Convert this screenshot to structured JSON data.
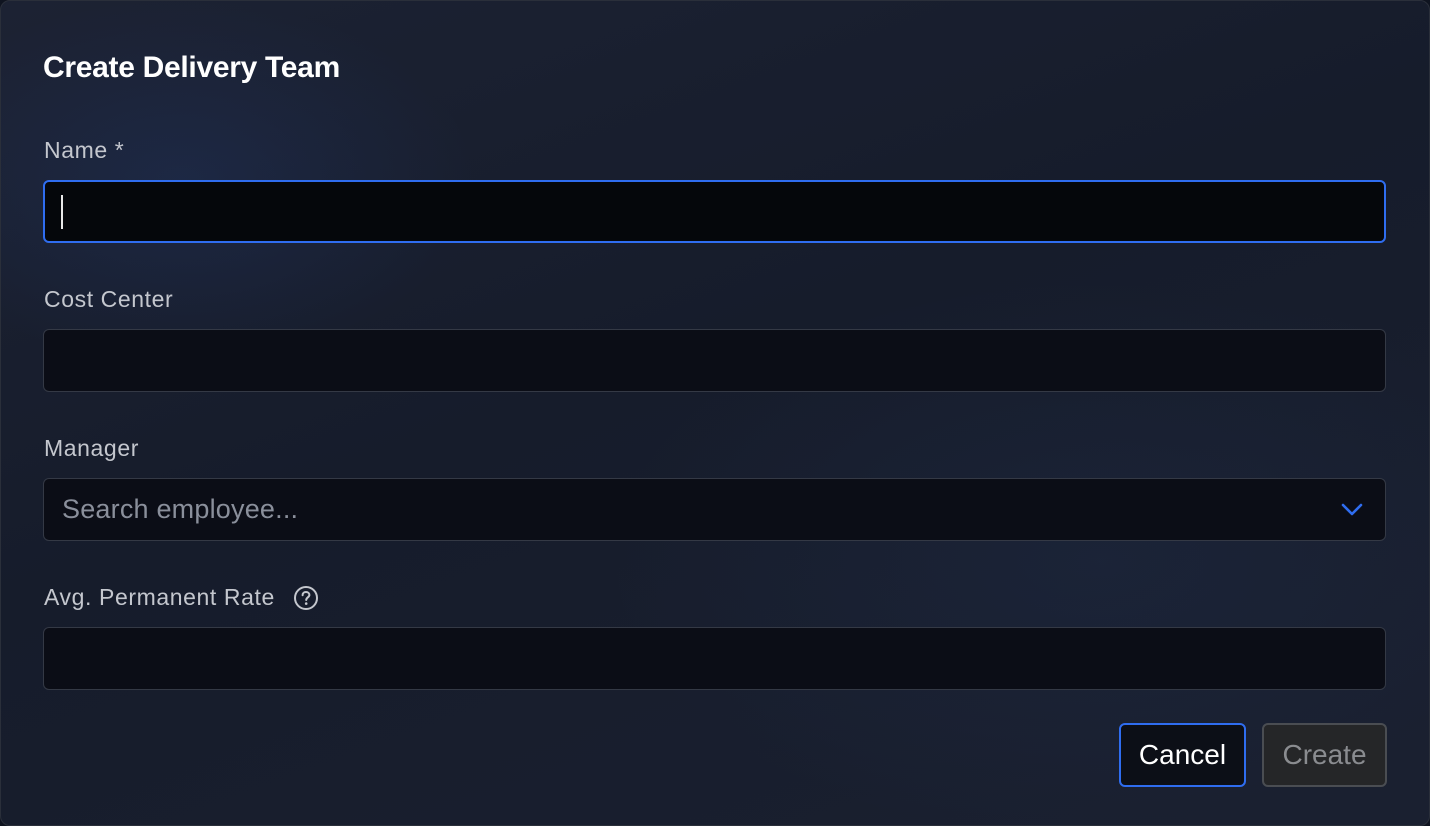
{
  "dialog": {
    "title": "Create Delivery Team"
  },
  "fields": {
    "name": {
      "label": "Name *",
      "value": "",
      "focused": true
    },
    "cost_center": {
      "label": "Cost Center",
      "value": ""
    },
    "manager": {
      "label": "Manager",
      "placeholder": "Search employee...",
      "icon": "chevron-down-icon"
    },
    "avg_permanent_rate": {
      "label": "Avg. Permanent Rate",
      "value": "",
      "icon": "help-circle-icon"
    }
  },
  "actions": {
    "cancel_label": "Cancel",
    "create_label": "Create",
    "create_disabled": true
  },
  "colors": {
    "accent": "#2f6df0",
    "background": "#1a2030",
    "input_bg": "#0b0d16",
    "disabled_bg": "#252628"
  }
}
